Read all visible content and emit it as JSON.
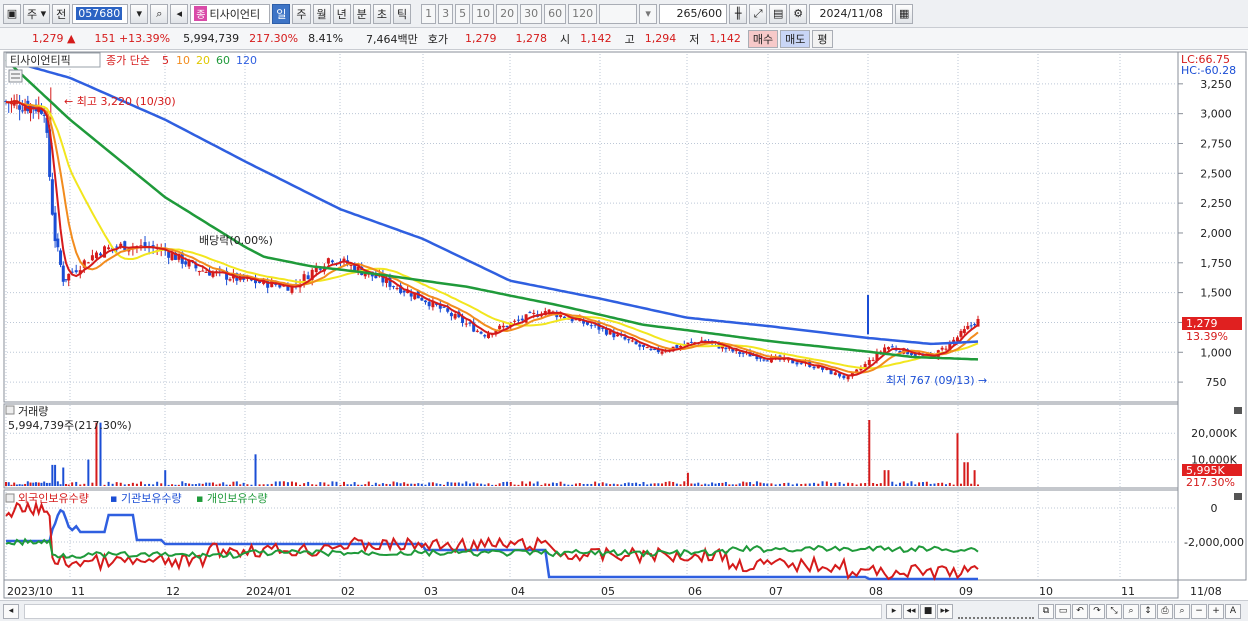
{
  "toolbar": {
    "market": "주",
    "prev_label": "전",
    "code": "057680",
    "name": "티사이언티",
    "badge": "종",
    "periods": [
      "일",
      "주",
      "월",
      "년",
      "분",
      "초",
      "틱"
    ],
    "active_period": "일",
    "intervals": [
      "1",
      "3",
      "5",
      "10",
      "20",
      "30",
      "60",
      "120"
    ],
    "count": "265",
    "count_total": "/600",
    "date": "2024/11/08"
  },
  "quote": {
    "price": "1,279",
    "change": "151",
    "change_pct": "+13.39%",
    "volume": "5,994,739",
    "vol_ratio": "217.30%",
    "turnover": "8.41%",
    "amount": "7,464백만",
    "hoga_label": "호가",
    "ask": "1,279",
    "bid": "1,278",
    "open_label": "시",
    "open": "1,142",
    "high_label": "고",
    "high": "1,294",
    "low_label": "저",
    "low": "1,142",
    "buy_label": "매수",
    "sell_label": "매도",
    "flat_label": "평"
  },
  "main_panel": {
    "legend_name": "티사이언티픽",
    "legend_type": "종가 단순",
    "ma_labels": [
      "5",
      "10",
      "20",
      "60",
      "120"
    ],
    "lc": "LC:66.75",
    "hc": "HC:-60.28",
    "annotation_high": "최고 3,220 (10/30)",
    "annotation_low": "최저 767 (09/13)",
    "annotation_div": "배당락(0.00%)",
    "price_tag": "1,279",
    "pct_tag": "13.39%"
  },
  "volume_panel": {
    "title": "거래량",
    "info": "5,994,739주(217.30%)",
    "tag": "5,995K",
    "pct_tag": "217.30%"
  },
  "holder_panel": {
    "labels": [
      "외국인보유수량",
      "기관보유수량",
      "개인보유수량"
    ]
  },
  "x_axis": {
    "labels": [
      "2023/10",
      "11",
      "12",
      "2024/01",
      "02",
      "03",
      "04",
      "05",
      "06",
      "07",
      "08",
      "09",
      "10",
      "11"
    ],
    "right_label": "11/08"
  },
  "colors": {
    "up": "#d51b1b",
    "down": "#1b4ed5",
    "ma5": "#d51b1b",
    "ma10": "#f28c1e",
    "ma20": "#f2e61e",
    "ma60": "#1f9a3a",
    "ma120": "#2f5fe0"
  },
  "chart_data": [
    {
      "type": "line",
      "title": "",
      "series_kind": "candlestick-with-moving-averages",
      "y_ticks": [
        "3,250",
        "3,000",
        "2,750",
        "2,500",
        "2,250",
        "2,000",
        "1,750",
        "1,500",
        "1,250",
        "1,000",
        "750"
      ],
      "ylim": [
        600,
        3500
      ],
      "x_ticks": [
        "2023/10",
        "11",
        "12",
        "2024/01",
        "02",
        "03",
        "04",
        "05",
        "06",
        "07",
        "08",
        "09",
        "10",
        "11"
      ],
      "anchors_close": [
        {
          "month": 0.0,
          "value": 3100
        },
        {
          "month": 0.6,
          "value": 3050
        },
        {
          "month": 0.75,
          "value": 2000
        },
        {
          "month": 0.9,
          "value": 1600
        },
        {
          "month": 1.3,
          "value": 1850
        },
        {
          "month": 1.6,
          "value": 1900
        },
        {
          "month": 2.0,
          "value": 1850
        },
        {
          "month": 2.4,
          "value": 1700
        },
        {
          "month": 3.0,
          "value": 1600
        },
        {
          "month": 3.5,
          "value": 1550
        },
        {
          "month": 3.9,
          "value": 1800
        },
        {
          "month": 4.2,
          "value": 1700
        },
        {
          "month": 5.0,
          "value": 1450
        },
        {
          "month": 5.7,
          "value": 1150
        },
        {
          "month": 6.4,
          "value": 1350
        },
        {
          "month": 7.0,
          "value": 1200
        },
        {
          "month": 7.6,
          "value": 1000
        },
        {
          "month": 8.2,
          "value": 1100
        },
        {
          "month": 8.6,
          "value": 1000
        },
        {
          "month": 9.4,
          "value": 900
        },
        {
          "month": 9.8,
          "value": 780
        },
        {
          "month": 10.2,
          "value": 1050
        },
        {
          "month": 10.7,
          "value": 950
        },
        {
          "month": 11.25,
          "value": 1279
        }
      ],
      "ma60": [
        {
          "month": 0.0,
          "value": 3450
        },
        {
          "month": 1.0,
          "value": 2950
        },
        {
          "month": 2.0,
          "value": 2300
        },
        {
          "month": 3.2,
          "value": 1800
        },
        {
          "month": 3.7,
          "value": 1720
        },
        {
          "month": 4.5,
          "value": 1650
        },
        {
          "month": 5.5,
          "value": 1550
        },
        {
          "month": 6.5,
          "value": 1400
        },
        {
          "month": 7.5,
          "value": 1230
        },
        {
          "month": 8.5,
          "value": 1140
        },
        {
          "month": 9.5,
          "value": 1050
        },
        {
          "month": 10.5,
          "value": 960
        },
        {
          "month": 11.25,
          "value": 940
        }
      ],
      "ma120": [
        {
          "month": 0.0,
          "value": 3450
        },
        {
          "month": 1.0,
          "value": 3300
        },
        {
          "month": 2.0,
          "value": 2950
        },
        {
          "month": 3.0,
          "value": 2600
        },
        {
          "month": 4.0,
          "value": 2200
        },
        {
          "month": 5.0,
          "value": 1950
        },
        {
          "month": 6.0,
          "value": 1600
        },
        {
          "month": 7.0,
          "value": 1450
        },
        {
          "month": 8.0,
          "value": 1290
        },
        {
          "month": 9.0,
          "value": 1220
        },
        {
          "month": 10.0,
          "value": 1120
        },
        {
          "month": 10.7,
          "value": 1070
        },
        {
          "month": 11.25,
          "value": 1090
        }
      ],
      "high_point": {
        "month": 0.7,
        "value": 3220
      },
      "low_point": {
        "month": 9.5,
        "value": 767
      }
    },
    {
      "type": "bar",
      "title": "거래량",
      "y_ticks": [
        "20,000K",
        "10,000K"
      ],
      "ylim": [
        0,
        25000
      ],
      "spikes": [
        {
          "month": 0.75,
          "value": 8000
        },
        {
          "month": 0.9,
          "value": 7000
        },
        {
          "month": 1.2,
          "value": 10000
        },
        {
          "month": 1.3,
          "value": 24000
        },
        {
          "month": 2.0,
          "value": 6000
        },
        {
          "month": 3.1,
          "value": 12000
        },
        {
          "month": 8.0,
          "value": 5000
        },
        {
          "month": 10.0,
          "value": 25000
        },
        {
          "month": 10.2,
          "value": 6000
        },
        {
          "month": 11.0,
          "value": 20000
        },
        {
          "month": 11.1,
          "value": 9000
        },
        {
          "month": 11.2,
          "value": 5995
        }
      ]
    },
    {
      "type": "line",
      "title": "외국인보유수량 / 기관보유수량 / 개인보유수량",
      "y_ticks": [
        "0",
        "-2,000,000"
      ]
    }
  ]
}
